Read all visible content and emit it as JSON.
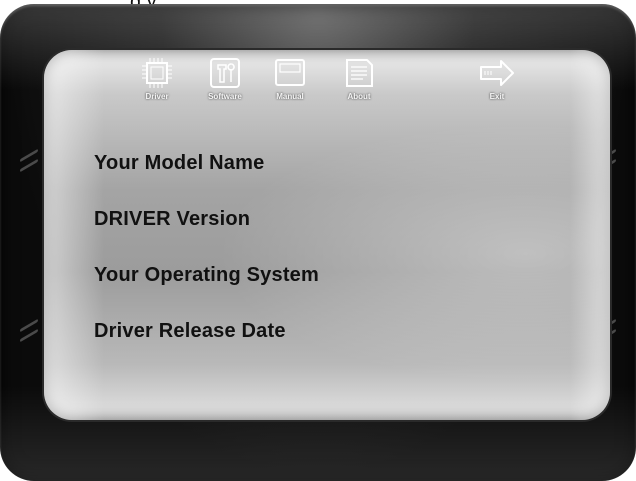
{
  "caption": "g                y",
  "menu": {
    "items": [
      {
        "label": "Driver",
        "icon": "chip-icon"
      },
      {
        "label": "Software",
        "icon": "tools-icon"
      },
      {
        "label": "Manual",
        "icon": "window-icon"
      },
      {
        "label": "About",
        "icon": "document-icon"
      },
      {
        "label": "Exit",
        "icon": "exit-arrow-icon"
      }
    ]
  },
  "info": {
    "model_name": "Your Model Name",
    "driver_version": "DRIVER Version",
    "operating_system": "Your Operating System",
    "release_date": "Driver Release Date"
  },
  "colors": {
    "frame": "#111111",
    "screen_top": "#efefef",
    "screen_mid": "#9c9c9c",
    "label": "#f4f4f4",
    "text": "#111111"
  }
}
